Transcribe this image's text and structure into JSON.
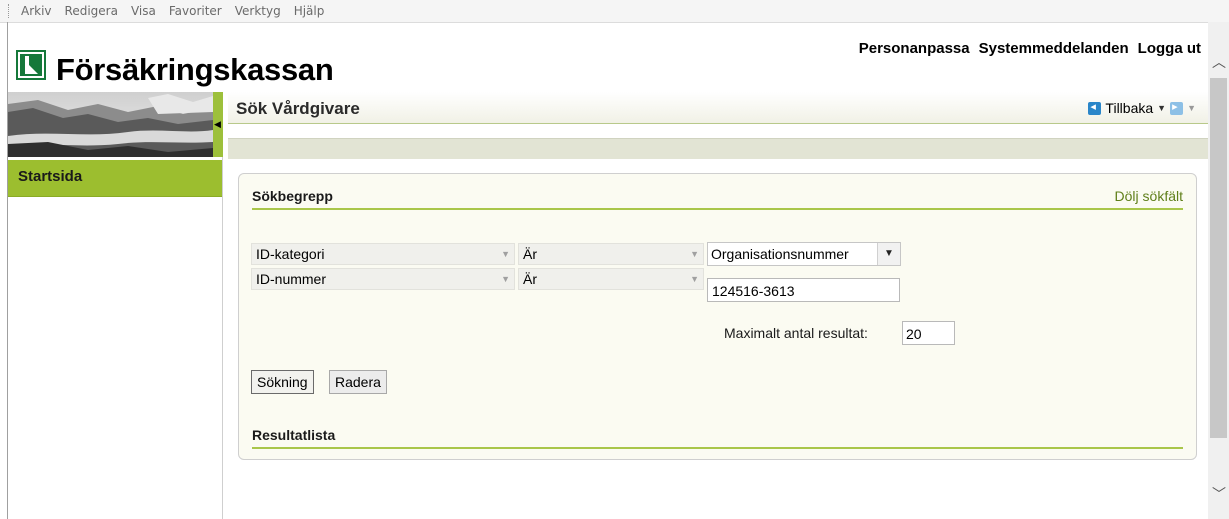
{
  "menubar": {
    "items": [
      "Arkiv",
      "Redigera",
      "Visa",
      "Favoriter",
      "Verktyg",
      "Hjälp"
    ]
  },
  "header": {
    "brand": "Försäkringskassan",
    "links": [
      "Personanpassa",
      "Systemmeddelanden",
      "Logga ut"
    ]
  },
  "sidebar": {
    "start_label": "Startsida"
  },
  "page": {
    "title": "Sök Vårdgivare",
    "back_label": "Tillbaka"
  },
  "search": {
    "section_title": "Sökbegrepp",
    "hide_link": "Dölj sökfält",
    "rows": [
      {
        "field": "ID-kategori",
        "operator": "Är",
        "value": "Organisationsnummer"
      },
      {
        "field": "ID-nummer",
        "operator": "Är",
        "value": "124516-3613"
      }
    ],
    "max_label": "Maximalt antal resultat:",
    "max_value": "20",
    "search_button": "Sökning",
    "clear_button": "Radera"
  },
  "results": {
    "section_title": "Resultatlista"
  },
  "colors": {
    "accent_green": "#9cbe2f",
    "logo_green": "#15783a",
    "link_green": "#5f7f1a",
    "nav_blue": "#2a86c9"
  },
  "icons": [
    "logo-icon",
    "back-arrow-icon",
    "forward-arrow-icon",
    "dropdown-arrow-icon",
    "collapse-arrow-icon"
  ]
}
